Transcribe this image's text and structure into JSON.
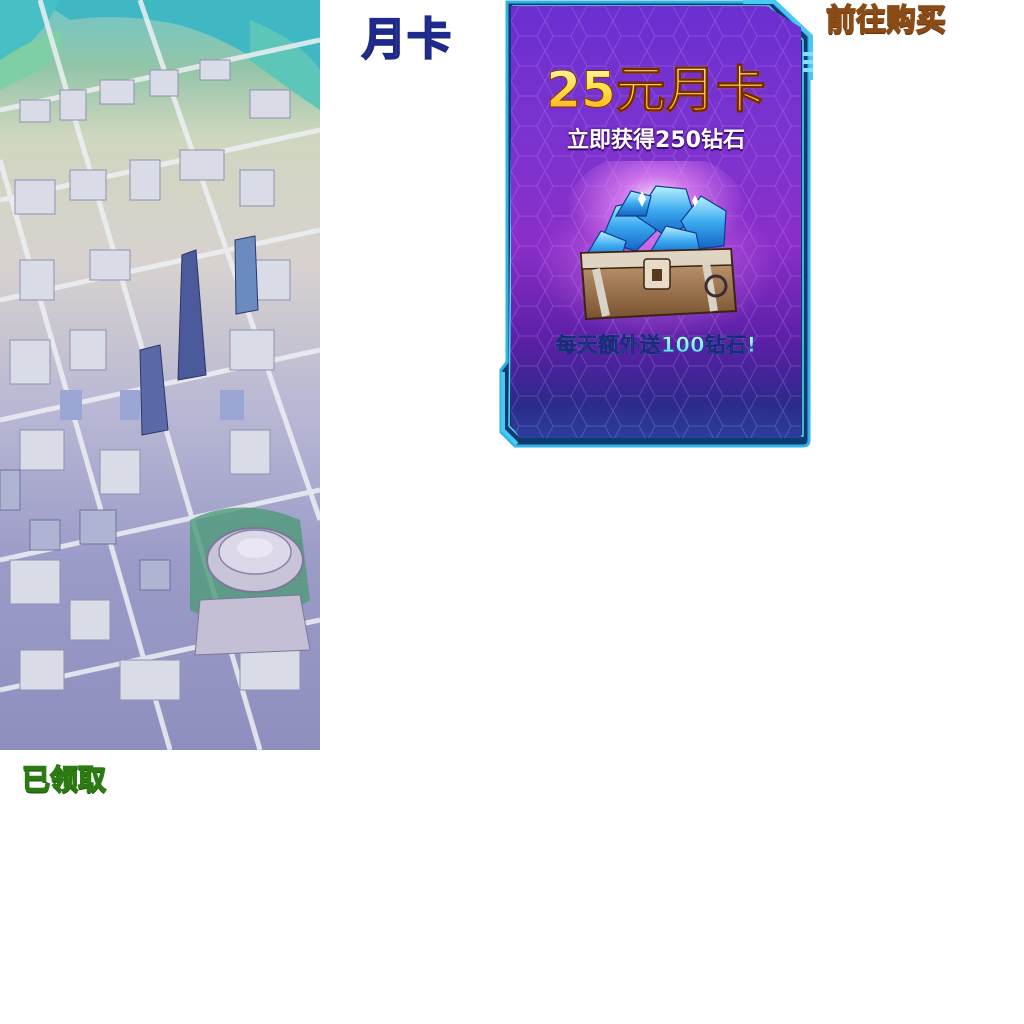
{
  "title": "月卡",
  "buy_button_label": "前往购买",
  "claimed_label": "已领取",
  "card": {
    "price": "25元月卡",
    "subtitle": "立即获得250钻石",
    "bonus": "每天额外送100钻石!"
  },
  "icons": {
    "city": "city-map-illustration",
    "chest": "diamond-chest-icon"
  },
  "colors": {
    "card_bg": "#7b33cf",
    "card_frame": "#2fb2e6",
    "title_fill": "#fff36b",
    "title_stroke": "#1d2a8c",
    "buy_text": "#fbe7c4",
    "claimed_text": "#d9ff6a"
  }
}
